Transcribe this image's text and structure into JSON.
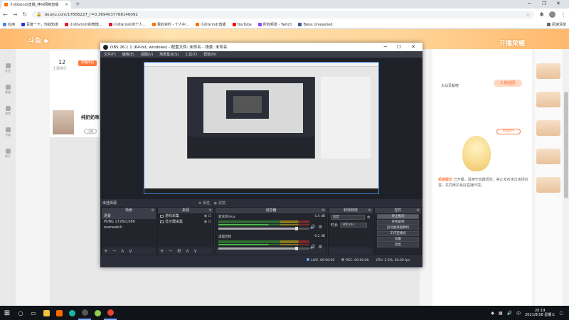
{
  "browser": {
    "tab_title": "小冰Grindr直播_神州网络直播",
    "new_tab": "+",
    "url": "douyu.com/17656227_r=0.3694037768146092",
    "bookmarks": [
      {
        "label": "应用",
        "color": "#4285f4"
      },
      {
        "label": "百度一下，你就知道",
        "color": "#2932e1"
      },
      {
        "label": "小冰Grindr的微博...",
        "color": "#e6162d"
      },
      {
        "label": "小冰Grindr的个人...",
        "color": "#e6162d"
      },
      {
        "label": "我的资料 - 个人中...",
        "color": "#ff7200"
      },
      {
        "label": "小冰Grindr直播",
        "color": "#ff7200"
      },
      {
        "label": "YouTube",
        "color": "#ff0000"
      },
      {
        "label": "所有频道 - Twitch",
        "color": "#9146ff"
      },
      {
        "label": "Bless Unleashed",
        "color": "#3b5998"
      }
    ],
    "reading_list": "阅读清单"
  },
  "douyu": {
    "left_rail": [
      "关注",
      "频道",
      "游戏",
      "分类",
      "娱乐"
    ],
    "room_count": "12",
    "room_caption": "土豪排行",
    "room_tag": "荣耀传说",
    "anchor_name": "纯奶奶咪",
    "anchor_btn": "订阅",
    "right_title": "大仙贡献榜",
    "right_pill": "1:粉丝团",
    "notice_head": "系统提示",
    "notice_text": "已开播，请遵守直播规范，禁止发布违法违规内容，共同维护良好直播环境。",
    "right_button": "办理VIP",
    "banner_right": "开播荣耀"
  },
  "obs": {
    "title": "OBS 26.1.1 (64-bit, windows) - 配置文件: 未命名 - 场景: 未命名",
    "menu": [
      "文件(F)",
      "编辑(E)",
      "视图(V)",
      "场景集合(S)",
      "工具(T)",
      "帮助(H)"
    ],
    "strip_label": "未选择源",
    "strip_props": "属性",
    "strip_filters": "滤镜",
    "scenes_header": "场景",
    "scenes": [
      "场景",
      "PUBG 1728x1080",
      "overwatch"
    ],
    "sources_header": "来源",
    "sources": [
      "游戏采集",
      "显示器采集"
    ],
    "mixer_header": "混音器",
    "tracks": [
      {
        "name": "麦克风/Aux",
        "db": "-1.4 dB"
      },
      {
        "name": "桌面音频",
        "db": "-0.2 dB"
      }
    ],
    "transitions_header": "转场特效",
    "transition_type": "淡出",
    "duration_label": "时长",
    "duration_value": "300 ms",
    "controls_header": "控件",
    "controls": [
      "停止推流",
      "开始录制",
      "启动虚拟摄像机",
      "工作室模式",
      "设置",
      "退出"
    ],
    "status": {
      "live": "LIVE: 00:00:00",
      "rec": "REC: 00:00:00",
      "cpu": "CPU: 2.3%, 60.00 fps"
    }
  },
  "taskbar": {
    "clock_time": "20:19",
    "clock_date": "2021/8/18 星期三",
    "lang": "中"
  }
}
